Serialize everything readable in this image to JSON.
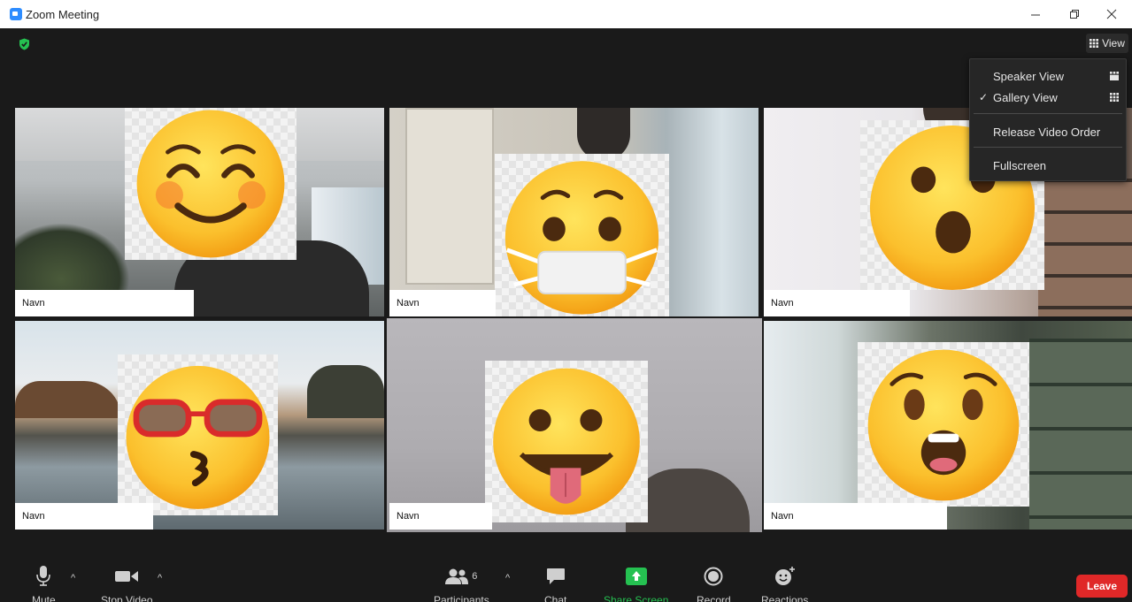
{
  "window": {
    "title": "Zoom Meeting",
    "min_icon": "minimize-icon",
    "max_icon": "restore-icon",
    "close_icon": "close-icon"
  },
  "topbar": {
    "security_icon": "shield-check-icon",
    "view_label": "View"
  },
  "view_menu": {
    "items": [
      {
        "label": "Speaker View",
        "checked": false,
        "icon": "speaker-view-icon"
      },
      {
        "label": "Gallery View",
        "checked": true,
        "icon": "gallery-grid-icon"
      },
      {
        "label": "Release Video Order",
        "checked": false
      },
      {
        "label": "Fullscreen",
        "checked": false
      }
    ],
    "check_glyph": "✓"
  },
  "tiles": [
    {
      "name": "Navn",
      "emoji": "smiling-blush-face",
      "active": false
    },
    {
      "name": "Navn",
      "emoji": "face-with-medical-mask",
      "active": false
    },
    {
      "name": "Navn",
      "emoji": "surprised-face",
      "active": false
    },
    {
      "name": "Navn",
      "emoji": "kissing-face-sunglasses",
      "active": false
    },
    {
      "name": "Navn",
      "emoji": "face-with-tongue",
      "active": true
    },
    {
      "name": "Navn",
      "emoji": "astonished-face",
      "active": false
    }
  ],
  "toolbar": {
    "mute_label": "Mute",
    "stop_video_label": "Stop Video",
    "participants_label": "Participants",
    "participants_count": "6",
    "chat_label": "Chat",
    "share_screen_label": "Share Screen",
    "record_label": "Record",
    "reactions_label": "Reactions",
    "leave_label": "Leave",
    "caret_glyph": "^"
  },
  "colors": {
    "accent_green": "#25c151",
    "leave_red": "#e02828",
    "active_speaker_border": "#d6e08a",
    "zoom_blue": "#2d8cff"
  }
}
